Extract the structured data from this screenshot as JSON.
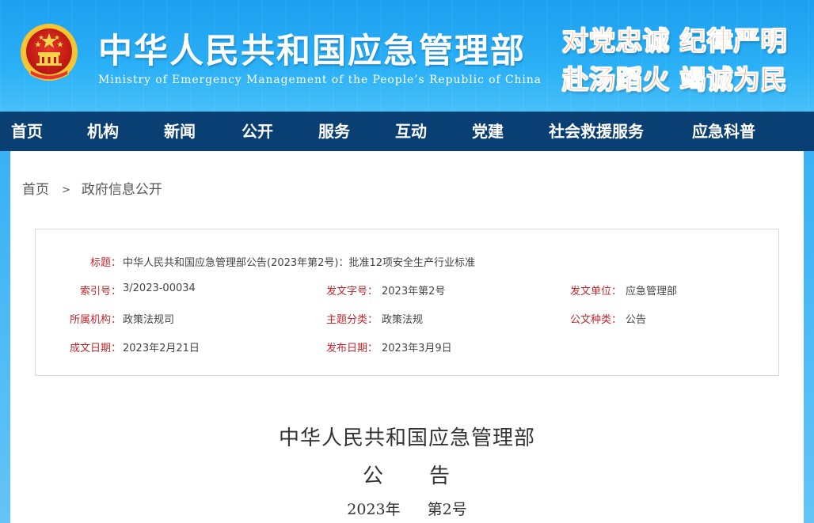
{
  "header": {
    "ministry_name": "中华人民共和国应急管理部",
    "ministry_en": "Ministry of Emergency Management of the People’s Republic of China",
    "slogan_line1": "对党忠诚 纪律严明",
    "slogan_line2": "赴汤蹈火 竭诚为民",
    "emblem_icon": "national-emblem-icon"
  },
  "nav": {
    "items": [
      "首页",
      "机构",
      "新闻",
      "公开",
      "服务",
      "互动",
      "党建",
      "社会救援服务",
      "应急科普"
    ]
  },
  "breadcrumb": {
    "home": "首页",
    "separator": ">",
    "current": "政府信息公开"
  },
  "info": {
    "title_label": "标题：",
    "title_value": "中华人民共和国应急管理部公告(2023年第2号)：批准12项安全生产行业标准",
    "index_label": "索引号：",
    "index_value": "3/2023-00034",
    "docno_label": "发文字号：",
    "docno_value": "2023年第2号",
    "issuer_label": "发文单位：",
    "issuer_value": "应急管理部",
    "dept_label": "所属机构：",
    "dept_value": "政策法规司",
    "topic_label": "主题分类：",
    "topic_value": "政策法规",
    "type_label": "公文种类：",
    "type_value": "公告",
    "made_label": "成文日期：",
    "made_value": "2023年2月21日",
    "pub_label": "发布日期：",
    "pub_value": "2023年3月9日"
  },
  "document": {
    "heading1": "中华人民共和国应急管理部",
    "heading2": "公　　告",
    "year": "2023年",
    "number": "第2号"
  },
  "colors": {
    "header_blue": "#1d9ff0",
    "nav_bg": "#0a3f73",
    "label_red": "#c1272d",
    "slogan_orange": "#f25a12"
  }
}
